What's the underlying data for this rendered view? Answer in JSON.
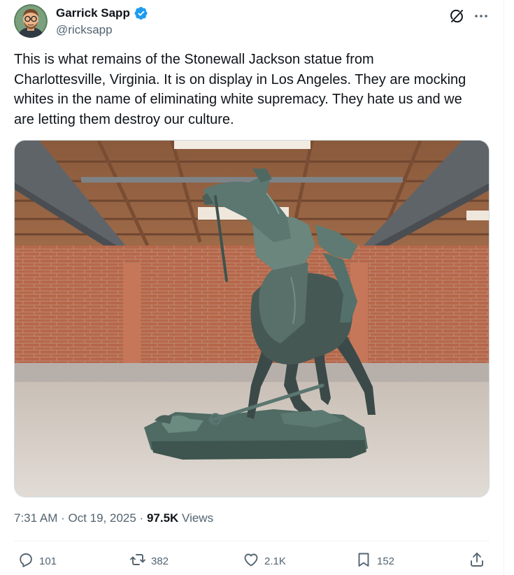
{
  "author": {
    "name": "Garrick Sapp",
    "handle": "@ricksapp",
    "verified": true
  },
  "header_icons": [
    "grok-icon",
    "more-icon"
  ],
  "tweet": {
    "text": "This is what remains of the Stonewall Jackson statue from\nCharlottesville, Virginia. It is on display in Los Angeles. They are mocking\nwhites in the name of eliminating white supremacy. They hate us and we\nare letting them destroy our culture."
  },
  "meta": {
    "timestamp": "7:31 AM · Oct 19, 2025",
    "separator": " · ",
    "views_count": "97.5K",
    "views_label": " Views"
  },
  "actions": {
    "replies": "101",
    "reposts": "382",
    "likes": "2.1K",
    "bookmarks": "152"
  },
  "colors": {
    "text": "#0f1419",
    "secondary": "#536471",
    "verified": "#1d9bf0",
    "border": "#cfd9de"
  }
}
